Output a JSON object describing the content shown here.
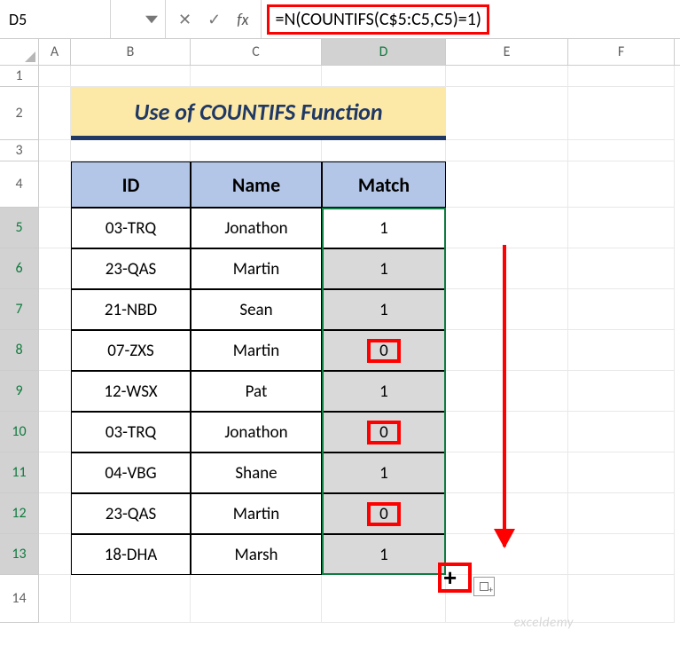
{
  "name_box": "D5",
  "formula": "=N(COUNTIFS(C$5:C5,C5)=1)",
  "fn_cancel": "✕",
  "fn_accept": "✓",
  "fn_label": "fx",
  "columns": [
    "A",
    "B",
    "C",
    "D",
    "E",
    "F"
  ],
  "row_numbers": [
    "1",
    "2",
    "3",
    "4",
    "5",
    "6",
    "7",
    "8",
    "9",
    "10",
    "11",
    "12",
    "13",
    "14"
  ],
  "title": "Use of COUNTIFS Function",
  "headers": {
    "id": "ID",
    "name": "Name",
    "match": "Match"
  },
  "rows": [
    {
      "id": "03-TRQ",
      "name": "Jonathon",
      "match": "1",
      "highlight": false
    },
    {
      "id": "23-QAS",
      "name": "Martin",
      "match": "1",
      "highlight": false
    },
    {
      "id": "21-NBD",
      "name": "Sean",
      "match": "1",
      "highlight": false
    },
    {
      "id": "07-ZXS",
      "name": "Martin",
      "match": "0",
      "highlight": true
    },
    {
      "id": "12-WSX",
      "name": "Pat",
      "match": "1",
      "highlight": false
    },
    {
      "id": "03-TRQ",
      "name": "Jonathon",
      "match": "0",
      "highlight": true
    },
    {
      "id": "04-VBG",
      "name": "Shane",
      "match": "1",
      "highlight": false
    },
    {
      "id": "23-QAS",
      "name": "Martin",
      "match": "0",
      "highlight": true
    },
    {
      "id": "18-DHA",
      "name": "Marsh",
      "match": "1",
      "highlight": false
    }
  ],
  "watermark": "exceldemy",
  "chart_data": {
    "type": "table",
    "title": "Use of COUNTIFS Function",
    "columns": [
      "ID",
      "Name",
      "Match"
    ],
    "rows": [
      [
        "03-TRQ",
        "Jonathon",
        1
      ],
      [
        "23-QAS",
        "Martin",
        1
      ],
      [
        "21-NBD",
        "Sean",
        1
      ],
      [
        "07-ZXS",
        "Martin",
        0
      ],
      [
        "12-WSX",
        "Pat",
        1
      ],
      [
        "03-TRQ",
        "Jonathon",
        0
      ],
      [
        "04-VBG",
        "Shane",
        1
      ],
      [
        "23-QAS",
        "Martin",
        0
      ],
      [
        "18-DHA",
        "Marsh",
        1
      ]
    ]
  }
}
